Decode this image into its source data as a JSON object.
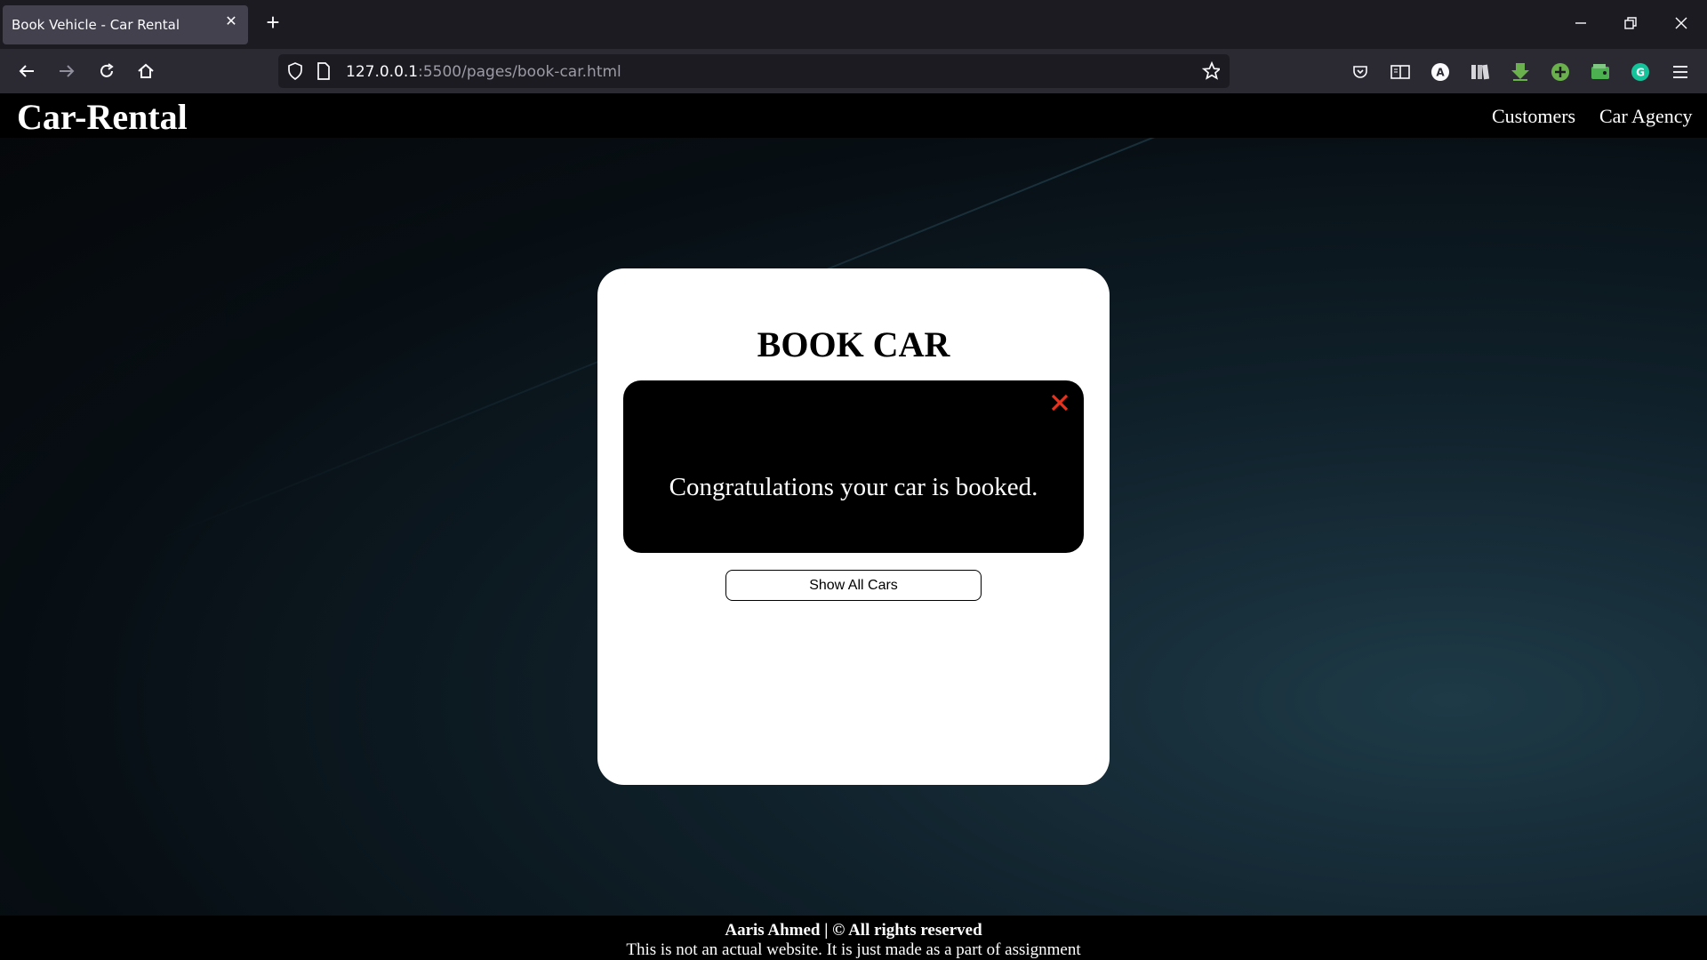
{
  "browser": {
    "tab_title": "Book Vehicle - Car Rental",
    "url_host": "127.0.0.1",
    "url_rest": ":5500/pages/book-car.html"
  },
  "site": {
    "brand": "Car-Rental",
    "nav": [
      "Customers",
      "Car Agency"
    ]
  },
  "card": {
    "title": "BOOK CAR",
    "alert_message": "Congratulations your car is booked.",
    "button_label": "Show All Cars"
  },
  "footer": {
    "line1": "Aaris Ahmed | © All rights reserved",
    "line2": "This is not an actual website. It is just made as a part of assignment"
  },
  "colors": {
    "alert_close": "#e8321e",
    "page_bg": "#0b161c"
  }
}
